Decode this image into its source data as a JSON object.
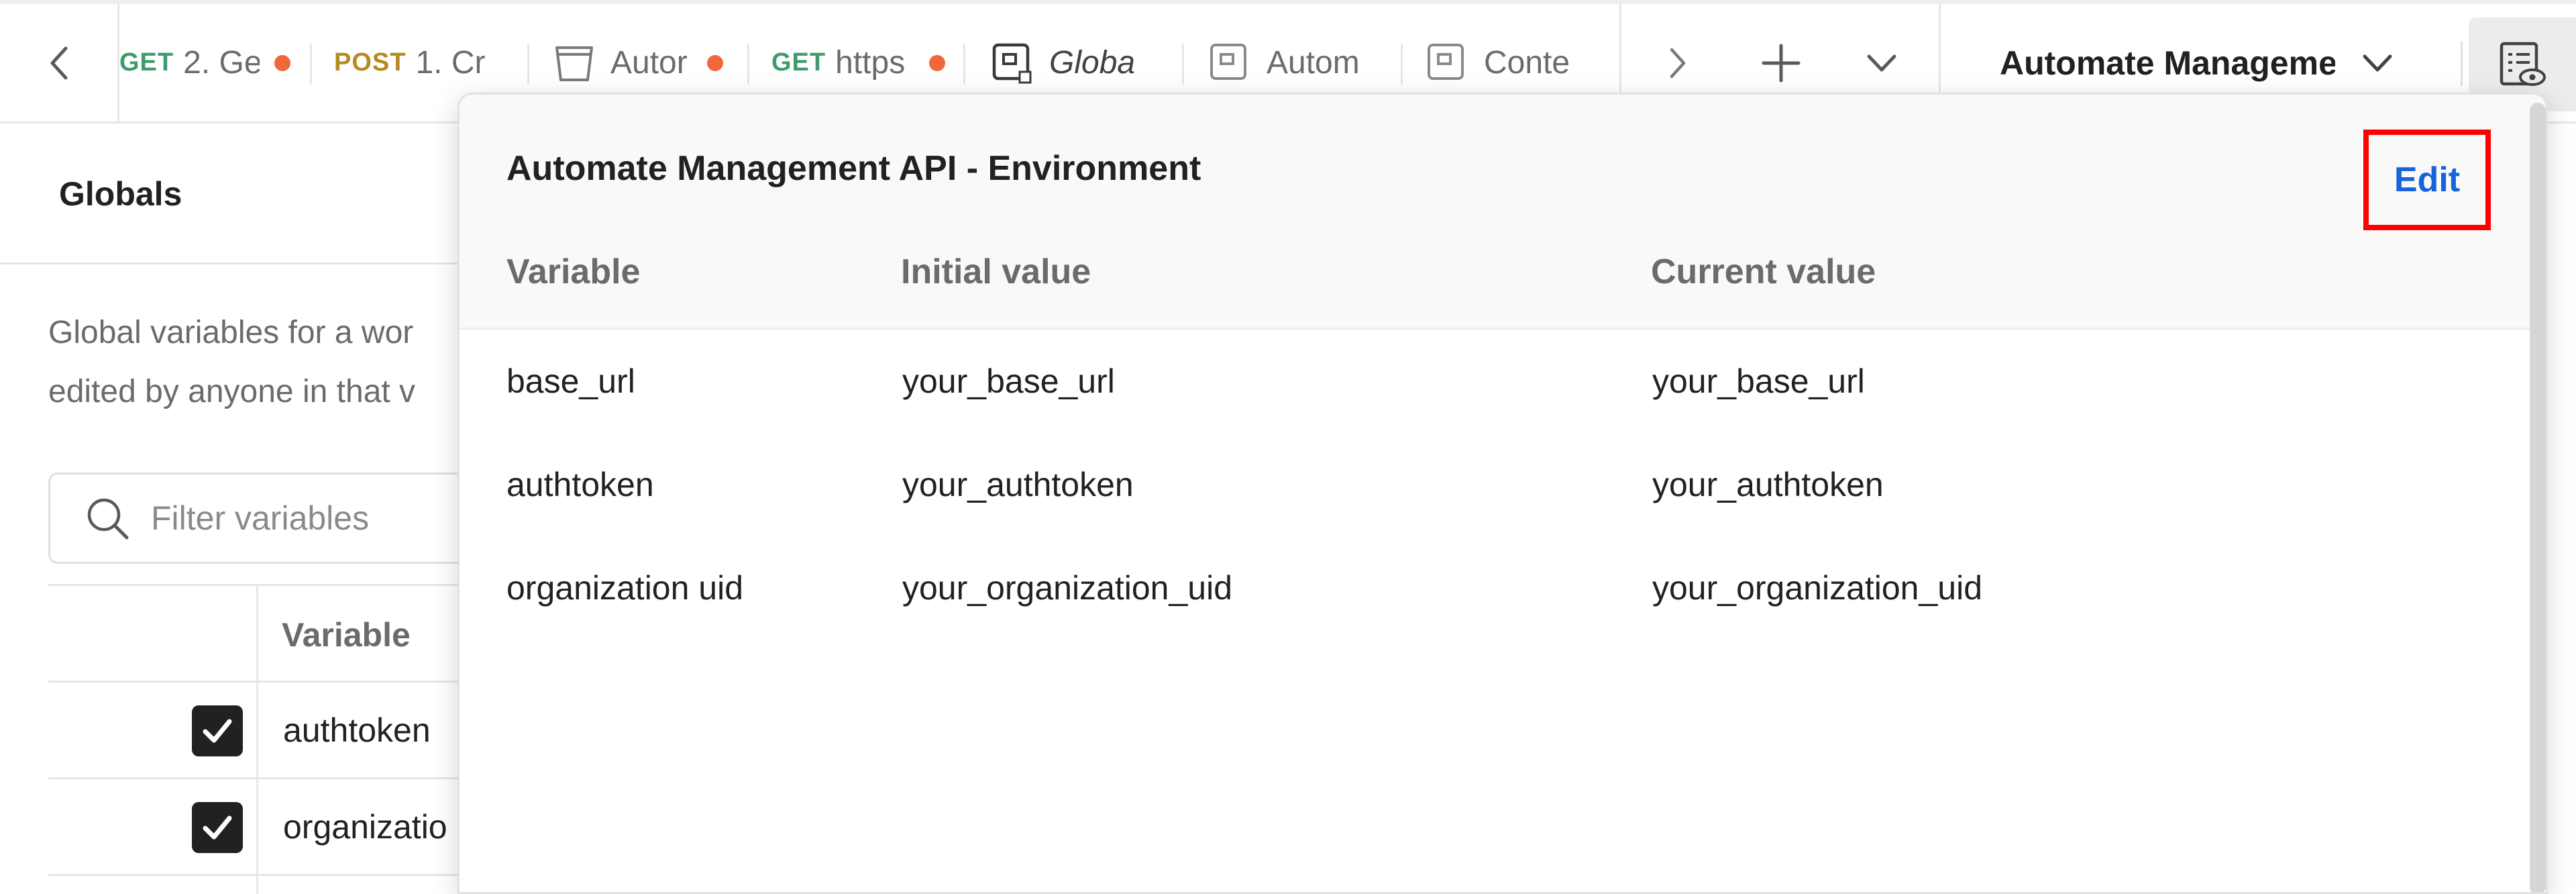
{
  "tabs": [
    {
      "method": "GET",
      "label": "2. Ge",
      "unsaved": true
    },
    {
      "method": "POST",
      "label": "1. Cr",
      "unsaved": false
    },
    {
      "method": "",
      "label": "Autor",
      "unsaved": true
    },
    {
      "method": "GET",
      "label": "https",
      "unsaved": true
    },
    {
      "method": "",
      "label": "Globa",
      "unsaved": false
    },
    {
      "method": "",
      "label": "Autom",
      "unsaved": false
    },
    {
      "method": "",
      "label": "Conte",
      "unsaved": false
    }
  ],
  "environment_selector": {
    "name": "Automate Managemen"
  },
  "globals": {
    "title": "Globals",
    "description_line1": "Global variables for a wor",
    "description_line2": "edited by anyone in that v",
    "filter_placeholder": "Filter variables",
    "column_variable": "Variable",
    "rows": [
      {
        "name": "authtoken",
        "checked": true
      },
      {
        "name": "organizatio",
        "checked": true
      }
    ]
  },
  "quick_look": {
    "title": "Automate Management API - Environment",
    "edit_label": "Edit",
    "columns": {
      "variable": "Variable",
      "initial": "Initial value",
      "current": "Current value"
    },
    "rows": [
      {
        "variable": "base_url",
        "initial": "your_base_url",
        "current": "your_base_url"
      },
      {
        "variable": "authtoken",
        "initial": "your_authtoken",
        "current": "your_authtoken"
      },
      {
        "variable": "organization uid",
        "initial": "your_organization_uid",
        "current": "your_organization_uid"
      }
    ]
  },
  "colors": {
    "get_method": "#3e9b6b",
    "post_method": "#b58a1f",
    "unsaved_dot": "#f0683a",
    "edit_link": "#1664d9",
    "highlight_box": "#ff0000"
  }
}
